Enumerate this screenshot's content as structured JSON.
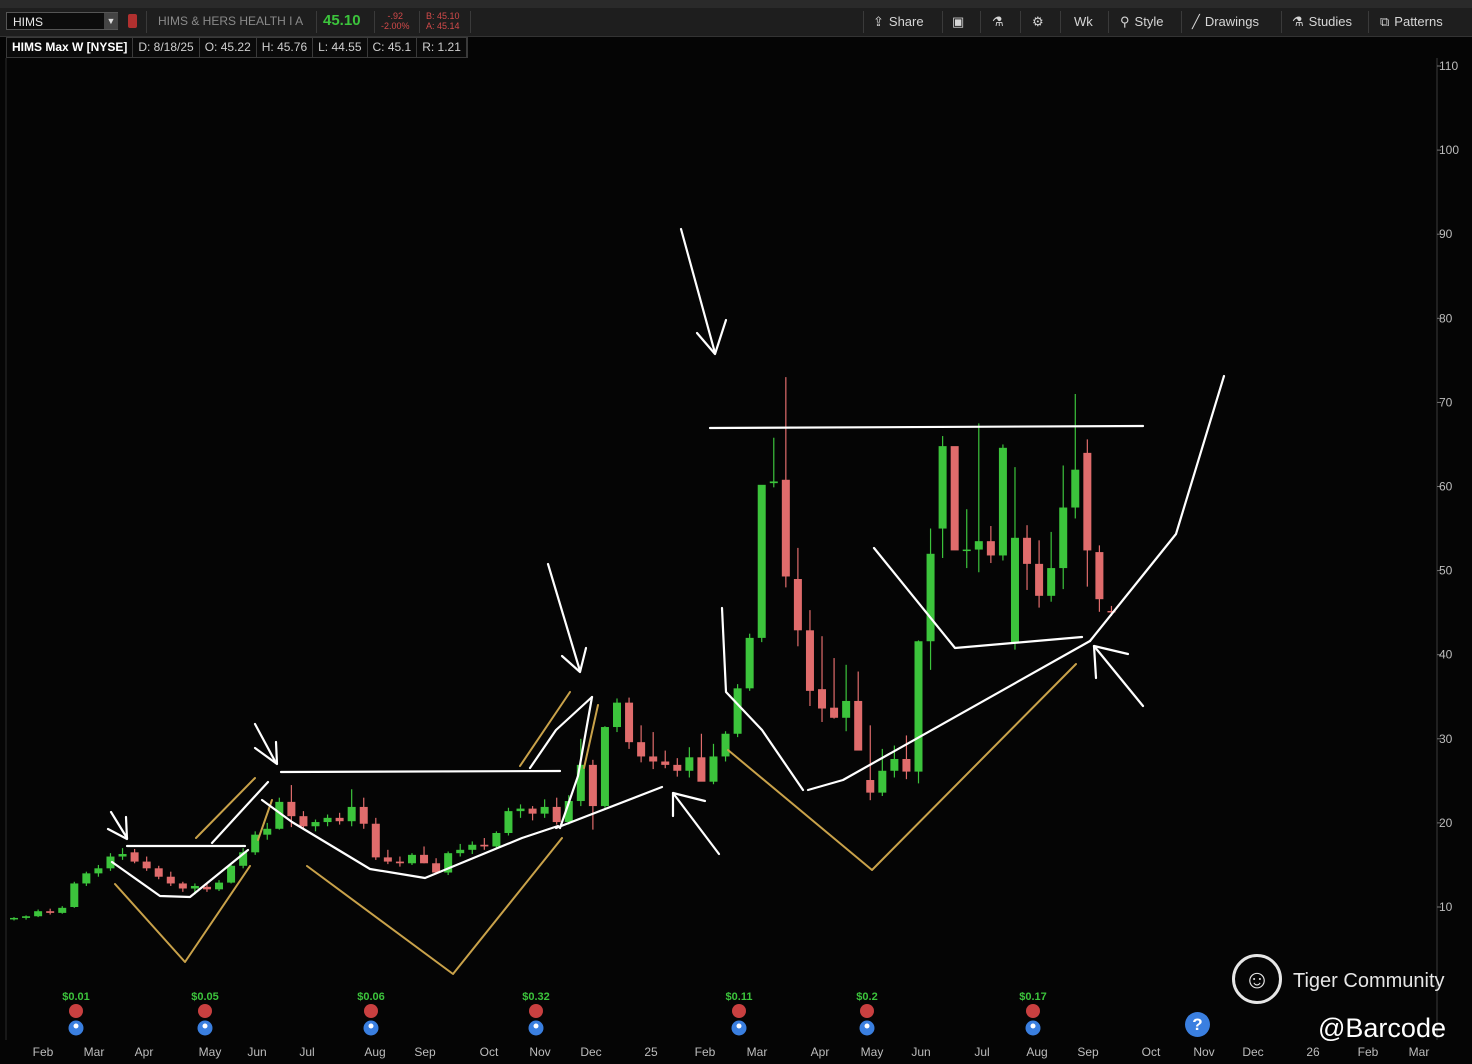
{
  "window": {
    "title_partial": ""
  },
  "toolbar": {
    "symbol": "HIMS",
    "company": "HIMS & HERS HEALTH I A",
    "last_price": "45.10",
    "change": "-.92",
    "change_pct": "-2.00%",
    "bid": "B: 45.10",
    "ask": "A: 45.14",
    "buttons": {
      "share": "Share",
      "wk": "Wk",
      "style": "Style",
      "drawings": "Drawings",
      "studies": "Studies",
      "patterns": "Patterns"
    },
    "icons": [
      "share-icon",
      "screenshot-icon",
      "flask-icon",
      "gear-icon",
      "style-icon",
      "pencil-icon",
      "studies-icon",
      "patterns-icon"
    ]
  },
  "infobar": {
    "title": "HIMS Max W [NYSE]",
    "date": "D: 8/18/25",
    "open": "O: 45.22",
    "high": "H: 45.76",
    "low": "L: 44.55",
    "close": "C: 45.1",
    "range": "R: 1.21"
  },
  "colors": {
    "up": "#3cc43c",
    "down": "#e06c6c",
    "annotation": "#ffffff",
    "trend_gold": "#c9a24a",
    "background": "#050505"
  },
  "chart_data": {
    "type": "candlestick",
    "ylim": [
      0,
      112
    ],
    "yticks": [
      10,
      20,
      30,
      40,
      50,
      60,
      70,
      80,
      90,
      100,
      110
    ],
    "xticks": [
      "Feb",
      "Mar",
      "Apr",
      "May",
      "Jun",
      "Jul",
      "Aug",
      "Sep",
      "Oct",
      "Nov",
      "Dec",
      "25",
      "Feb",
      "Mar",
      "Apr",
      "May",
      "Jun",
      "Jul",
      "Aug",
      "Sep",
      "Oct",
      "Nov",
      "Dec",
      "26",
      "Feb",
      "Mar"
    ],
    "candles": [
      [
        8.6,
        8.8,
        8.4,
        8.7
      ],
      [
        8.7,
        9.0,
        8.5,
        8.9
      ],
      [
        8.9,
        9.7,
        8.8,
        9.5
      ],
      [
        9.5,
        9.8,
        9.1,
        9.3
      ],
      [
        9.3,
        10.1,
        9.2,
        9.9
      ],
      [
        10.0,
        13.0,
        9.9,
        12.8
      ],
      [
        12.8,
        14.2,
        12.5,
        14.0
      ],
      [
        14.0,
        15.0,
        13.6,
        14.6
      ],
      [
        14.6,
        16.4,
        14.3,
        16.0
      ],
      [
        16.0,
        17.0,
        15.6,
        16.3
      ],
      [
        16.5,
        16.9,
        15.2,
        15.4
      ],
      [
        15.4,
        16.0,
        14.3,
        14.6
      ],
      [
        14.6,
        14.9,
        13.3,
        13.6
      ],
      [
        13.6,
        14.2,
        12.5,
        12.8
      ],
      [
        12.8,
        13.0,
        11.8,
        12.2
      ],
      [
        12.2,
        12.8,
        11.5,
        12.5
      ],
      [
        12.4,
        12.9,
        11.8,
        12.1
      ],
      [
        12.1,
        13.2,
        11.9,
        12.9
      ],
      [
        12.9,
        15.0,
        12.8,
        14.9
      ],
      [
        14.9,
        17.0,
        14.6,
        16.5
      ],
      [
        16.5,
        19.0,
        16.2,
        18.6
      ],
      [
        18.6,
        20.0,
        18.0,
        19.3
      ],
      [
        19.3,
        23.0,
        19.2,
        22.5
      ],
      [
        22.5,
        24.5,
        19.5,
        20.8
      ],
      [
        20.8,
        21.4,
        19.3,
        19.6
      ],
      [
        19.6,
        20.4,
        19.0,
        20.1
      ],
      [
        20.1,
        21.0,
        19.6,
        20.6
      ],
      [
        20.6,
        21.2,
        19.8,
        20.2
      ],
      [
        20.2,
        24.0,
        19.6,
        21.9
      ],
      [
        21.9,
        23.0,
        19.3,
        19.9
      ],
      [
        19.9,
        20.6,
        15.6,
        15.9
      ],
      [
        15.9,
        16.8,
        15.1,
        15.4
      ],
      [
        15.4,
        16.0,
        14.8,
        15.2
      ],
      [
        15.2,
        16.4,
        15.0,
        16.2
      ],
      [
        16.2,
        17.2,
        15.2,
        15.2
      ],
      [
        15.2,
        15.8,
        13.9,
        14.1
      ],
      [
        14.1,
        16.6,
        13.8,
        16.4
      ],
      [
        16.4,
        17.5,
        16.0,
        16.8
      ],
      [
        16.8,
        17.8,
        16.3,
        17.4
      ],
      [
        17.4,
        18.2,
        16.8,
        17.2
      ],
      [
        17.2,
        19.0,
        17.0,
        18.8
      ],
      [
        18.8,
        21.8,
        18.5,
        21.4
      ],
      [
        21.4,
        22.2,
        20.6,
        21.7
      ],
      [
        21.7,
        22.0,
        20.3,
        21.1
      ],
      [
        21.1,
        22.8,
        20.6,
        21.9
      ],
      [
        21.9,
        23.0,
        19.8,
        20.1
      ],
      [
        20.1,
        23.3,
        19.8,
        22.6
      ],
      [
        22.6,
        30.0,
        22.0,
        26.9
      ],
      [
        26.9,
        27.5,
        19.2,
        22.0
      ],
      [
        22.0,
        31.5,
        21.8,
        31.4
      ],
      [
        31.4,
        34.8,
        30.8,
        34.3
      ],
      [
        34.3,
        34.9,
        28.8,
        29.6
      ],
      [
        29.6,
        31.6,
        27.2,
        27.9
      ],
      [
        27.9,
        30.8,
        26.4,
        27.3
      ],
      [
        27.3,
        28.6,
        26.5,
        26.9
      ],
      [
        26.9,
        27.7,
        25.5,
        26.2
      ],
      [
        26.2,
        29.0,
        25.4,
        27.8
      ],
      [
        27.8,
        30.6,
        25.2,
        24.9
      ],
      [
        24.9,
        29.4,
        24.6,
        27.9
      ],
      [
        27.9,
        30.9,
        27.3,
        30.6
      ],
      [
        30.6,
        36.5,
        30.2,
        36.0
      ],
      [
        36.0,
        42.5,
        35.7,
        42.0
      ],
      [
        42.0,
        58.0,
        41.5,
        60.2
      ],
      [
        60.4,
        65.8,
        59.9,
        60.6
      ],
      [
        60.8,
        73.0,
        48.0,
        49.3
      ],
      [
        49.0,
        52.7,
        41.0,
        42.9
      ],
      [
        42.9,
        45.3,
        33.9,
        35.7
      ],
      [
        35.9,
        42.2,
        32.0,
        33.6
      ],
      [
        33.7,
        39.6,
        32.4,
        32.5
      ],
      [
        32.5,
        38.8,
        30.9,
        34.5
      ],
      [
        34.5,
        38.0,
        29.1,
        28.6
      ],
      [
        25.1,
        31.6,
        22.7,
        23.6
      ],
      [
        23.6,
        28.8,
        23.2,
        26.2
      ],
      [
        26.2,
        29.2,
        25.4,
        27.6
      ],
      [
        27.6,
        30.4,
        25.2,
        26.1
      ],
      [
        26.1,
        41.7,
        24.7,
        41.6
      ],
      [
        41.6,
        55.0,
        38.2,
        52.0
      ],
      [
        55.0,
        66.0,
        51.5,
        64.8
      ],
      [
        64.8,
        63.7,
        53.5,
        52.4
      ],
      [
        52.5,
        57.3,
        50.3,
        52.5
      ],
      [
        52.5,
        67.5,
        49.8,
        53.5
      ],
      [
        53.5,
        55.3,
        50.9,
        51.8
      ],
      [
        51.8,
        65.0,
        51.2,
        64.6
      ],
      [
        41.5,
        62.3,
        40.6,
        53.9
      ],
      [
        53.9,
        55.4,
        47.7,
        50.8
      ],
      [
        50.8,
        53.6,
        45.6,
        47.0
      ],
      [
        47.0,
        54.6,
        46.3,
        50.3
      ],
      [
        50.3,
        62.5,
        47.8,
        57.5
      ],
      [
        57.5,
        71.0,
        56.2,
        62.0
      ],
      [
        64.0,
        65.6,
        48.1,
        52.4
      ],
      [
        52.2,
        53.0,
        45.1,
        46.6
      ],
      [
        45.2,
        45.8,
        44.6,
        45.1
      ]
    ],
    "annotations": {
      "earnings": [
        "$0.01",
        "$0.05",
        "$0.06",
        "$0.32",
        "$0.11",
        "$0.2",
        "$0.17"
      ]
    }
  },
  "watermark": {
    "brand": "Tiger Community",
    "handle": "@Barcode"
  },
  "help_label": "?"
}
